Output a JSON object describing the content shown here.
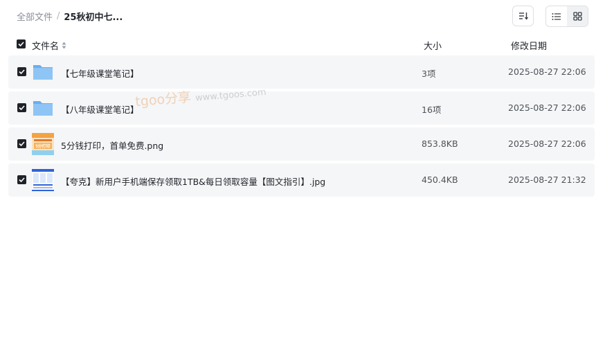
{
  "breadcrumb": {
    "root": "全部文件",
    "separator": "/",
    "current": "25秋初中七..."
  },
  "header": {
    "name_label": "文件名",
    "size_label": "大小",
    "date_label": "修改日期"
  },
  "files": [
    {
      "name": "【七年级课堂笔记】",
      "size": "3项",
      "date": "2025-08-27 22:06",
      "type": "folder-icon"
    },
    {
      "name": "【八年级课堂笔记】",
      "size": "16项",
      "date": "2025-08-27 22:06",
      "type": "folder-icon"
    },
    {
      "name": "5分钱打印，首单免费.png",
      "size": "853.8KB",
      "date": "2025-08-27 22:06",
      "type": "image-thumbnail",
      "thumb_text": "5分打印"
    },
    {
      "name": "【夸克】新用户手机端保存领取1TB&每日领取容量【图文指引】.jpg",
      "size": "450.4KB",
      "date": "2025-08-27 21:32",
      "type": "image-thumbnail"
    }
  ],
  "watermark": {
    "brand": "tgoo分享",
    "url": "www.tgoos.com"
  },
  "colors": {
    "row_background": "#f5f6f7",
    "checkbox": "#1f2329",
    "folder": "#7cb7f0",
    "text": "#1f2329",
    "muted": "#8a8f99"
  }
}
